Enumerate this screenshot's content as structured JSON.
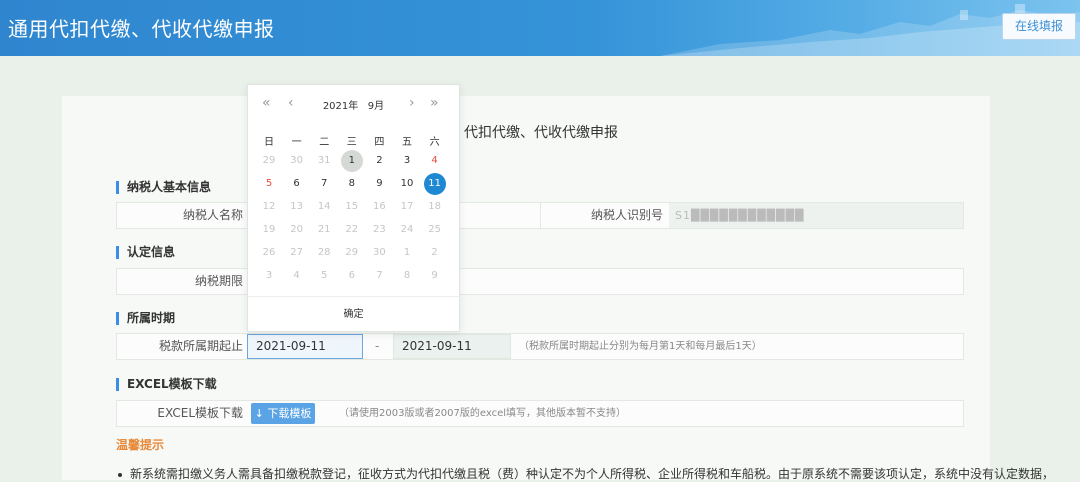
{
  "header": {
    "title": "通用代扣代缴、代收代缴申报",
    "online_button": "在线填报"
  },
  "form": {
    "title": "代扣代缴、代收代缴申报",
    "sections": {
      "taxpayer_basic": "纳税人基本信息",
      "certification": "认定信息",
      "period": "所属时期",
      "excel": "EXCEL模板下载"
    },
    "taxpayer_name_label": "纳税人名称",
    "taxpayer_id_label": "纳税人识别号",
    "taxpayer_id_value": "S1████████████",
    "tax_period_label": "纳税期限",
    "period_start_label": "税款所属期起止",
    "period_start_value": "2021-09-11",
    "period_dash": "-",
    "period_end_value": "2021-09-11",
    "period_hint": "（税款所属时期起止分别为每月第1天和每月最后1天）",
    "excel_label": "EXCEL模板下载",
    "download_button": "↓ 下载模板",
    "excel_hint": "（请使用2003版或者2007版的excel填写，其他版本暂不支持）",
    "warm_tip_title": "温馨提示",
    "warm_tip_text": "新系统需扣缴义务人需具备扣缴税款登记，征收方式为代扣代缴且税（费）种认定不为个人所得税、企业所得税和车船税。由于原系统不需要该项认定，系统中没有认定数据，"
  },
  "calendar": {
    "year_month": "2021年   9月",
    "nav_prev_year": "«",
    "nav_prev_month": "‹",
    "nav_next_month": "›",
    "nav_next_year": "»",
    "weekdays": [
      "日",
      "一",
      "二",
      "三",
      "四",
      "五",
      "六"
    ],
    "weeks": [
      [
        {
          "d": "29",
          "s": "other"
        },
        {
          "d": "30",
          "s": "other"
        },
        {
          "d": "31",
          "s": "other"
        },
        {
          "d": "1",
          "s": "today"
        },
        {
          "d": "2",
          "s": "cur"
        },
        {
          "d": "3",
          "s": "cur"
        },
        {
          "d": "4",
          "s": "hol"
        }
      ],
      [
        {
          "d": "5",
          "s": "hol"
        },
        {
          "d": "6",
          "s": "cur"
        },
        {
          "d": "7",
          "s": "cur"
        },
        {
          "d": "8",
          "s": "cur"
        },
        {
          "d": "9",
          "s": "cur"
        },
        {
          "d": "10",
          "s": "cur"
        },
        {
          "d": "11",
          "s": "sel"
        }
      ],
      [
        {
          "d": "12",
          "s": "dis"
        },
        {
          "d": "13",
          "s": "dis"
        },
        {
          "d": "14",
          "s": "dis"
        },
        {
          "d": "15",
          "s": "dis"
        },
        {
          "d": "16",
          "s": "dis"
        },
        {
          "d": "17",
          "s": "dis"
        },
        {
          "d": "18",
          "s": "dis"
        }
      ],
      [
        {
          "d": "19",
          "s": "dis"
        },
        {
          "d": "20",
          "s": "dis"
        },
        {
          "d": "21",
          "s": "dis"
        },
        {
          "d": "22",
          "s": "dis"
        },
        {
          "d": "23",
          "s": "dis"
        },
        {
          "d": "24",
          "s": "dis"
        },
        {
          "d": "25",
          "s": "dis"
        }
      ],
      [
        {
          "d": "26",
          "s": "dis"
        },
        {
          "d": "27",
          "s": "dis"
        },
        {
          "d": "28",
          "s": "dis"
        },
        {
          "d": "29",
          "s": "dis"
        },
        {
          "d": "30",
          "s": "dis"
        },
        {
          "d": "1",
          "s": "other"
        },
        {
          "d": "2",
          "s": "other"
        }
      ],
      [
        {
          "d": "3",
          "s": "other"
        },
        {
          "d": "4",
          "s": "other"
        },
        {
          "d": "5",
          "s": "other"
        },
        {
          "d": "6",
          "s": "other"
        },
        {
          "d": "7",
          "s": "other"
        },
        {
          "d": "8",
          "s": "other"
        },
        {
          "d": "9",
          "s": "other"
        }
      ]
    ],
    "confirm": "确定"
  },
  "colors": {
    "accent": "#1e88d3",
    "holiday": "#e74c3c",
    "warm_tip": "#e88a3a"
  }
}
